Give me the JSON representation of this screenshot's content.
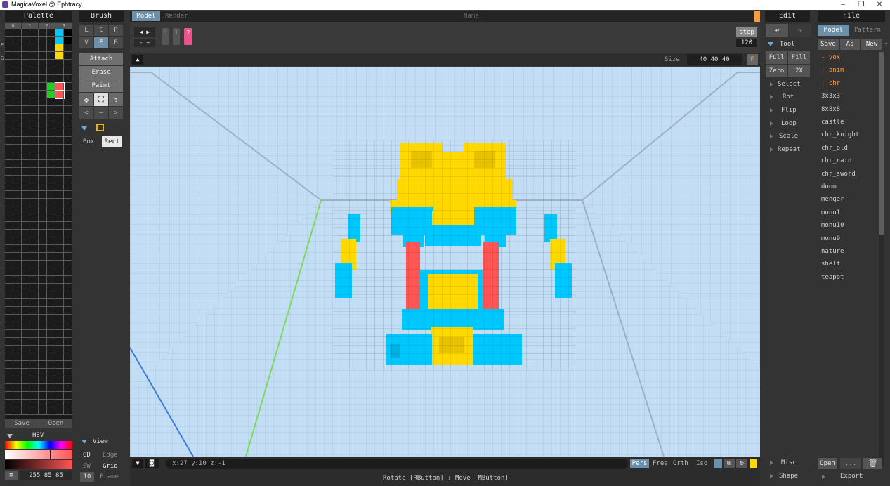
{
  "window": {
    "title": "MagicaVoxel @ Ephtracy",
    "min": "–",
    "restore": "❐",
    "close": "✕"
  },
  "palette": {
    "header": "Palette",
    "tabs": [
      "0",
      "1",
      "2",
      "3"
    ],
    "side_labels": [
      "E",
      "G"
    ],
    "save": "Save",
    "open": "Open",
    "hsv_label": "HSV",
    "rgb_value": "255 85 85",
    "menu_icon": "≡",
    "swatches": {
      "cyan": "#00c8ff",
      "yellow": "#ffd800",
      "green": "#22cc22",
      "red": "#ff5555",
      "black": "#000000"
    }
  },
  "brush": {
    "header": "Brush",
    "modes_row1": [
      "L",
      "C",
      "P"
    ],
    "modes_row2": [
      "V",
      "F",
      "B"
    ],
    "actions": [
      "Attach",
      "Erase",
      "Paint"
    ],
    "nav": [
      "<",
      "—",
      ">"
    ],
    "shape_box": "Box",
    "shape_rect": "Rect"
  },
  "view": {
    "label": "View",
    "gd": "GD",
    "edge": "Edge",
    "sw": "SW",
    "grid": "Grid",
    "frame_num": "10",
    "frame": "Frame"
  },
  "tabs": {
    "model": "Model",
    "render": "Render",
    "name": "Name"
  },
  "frames": {
    "labels": [
      "0",
      "1",
      "2"
    ],
    "step_label": "step",
    "step_value": "120"
  },
  "size": {
    "label": "Size",
    "value": "40 40 40",
    "f_button": "F"
  },
  "bottom": {
    "coords": "x:27  y:10  z:-1",
    "projections": [
      "Pers",
      "Free",
      "Orth",
      "Iso"
    ],
    "status": "Rotate [RButton] : Move [MButton]"
  },
  "edit": {
    "header": "Edit",
    "tool_label": "Tool",
    "tool_buttons": [
      "Full",
      "Fill",
      "Zero",
      "2X"
    ],
    "menu": [
      "Select",
      "Rot",
      "Flip",
      "Loop",
      "Scale",
      "Repeat"
    ],
    "misc": "Misc",
    "shape": "Shape"
  },
  "file": {
    "header": "File",
    "tab_model": "Model",
    "tab_pattern": "Pattern",
    "save": "Save",
    "as": "As",
    "new": "New",
    "plus": "+",
    "items": [
      "- vox",
      "| anim",
      "| chr",
      "3x3x3",
      "8x8x8",
      "castle",
      "chr_knight",
      "chr_old",
      "chr_rain",
      "chr_sword",
      "doom",
      "menger",
      "monu1",
      "monu10",
      "monu9",
      "nature",
      "shelf",
      "teapot"
    ],
    "open": "Open",
    "dots": "...",
    "export": "Export"
  },
  "colors": {
    "viewport_bg": "#c3ddf4",
    "grid_line": "#a9c9e4",
    "cyan": "#00c8ff",
    "yellow": "#ffd800",
    "red": "#ff5555",
    "accent_orange": "#ff9a3c",
    "accent_blue": "#6d8fa8"
  }
}
